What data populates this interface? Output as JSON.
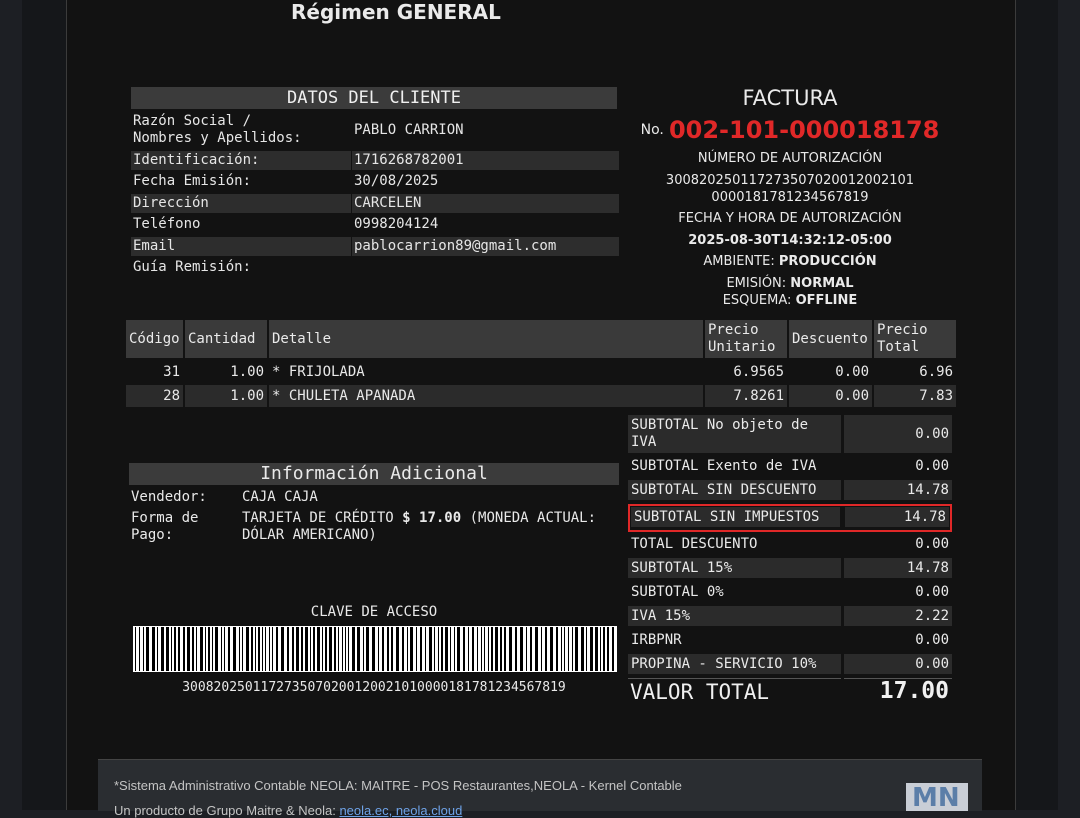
{
  "header": {
    "regimen": "Régimen GENERAL"
  },
  "cliente": {
    "title": "DATOS DEL CLIENTE",
    "rows": [
      {
        "label": "Razón Social /\nNombres y Apellidos:",
        "value": "PABLO CARRION"
      },
      {
        "label": "Identificación:",
        "value": "1716268782001"
      },
      {
        "label": "Fecha Emisión:",
        "value": "30/08/2025"
      },
      {
        "label": "Dirección",
        "value": "CARCELEN"
      },
      {
        "label": "Teléfono",
        "value": "0998204124"
      },
      {
        "label": "Email",
        "value": "pablocarrion89@gmail.com"
      },
      {
        "label": "Guía Remisión:",
        "value": ""
      }
    ]
  },
  "factura": {
    "title": "FACTURA",
    "no_label": "No.",
    "number": "002-101-000018178",
    "auth_title": "NÚMERO DE AUTORIZACIÓN",
    "auth_line1": "300820250117273507020012002101",
    "auth_line2": "0000181781234567819",
    "fecha_title": "FECHA Y HORA DE AUTORIZACIÓN",
    "fecha_value": "2025-08-30T14:32:12-05:00",
    "ambiente_label": "AMBIENTE:",
    "ambiente_value": "PRODUCCIÓN",
    "emision_label": "EMISIÓN:",
    "emision_value": "NORMAL",
    "esquema_label": "ESQUEMA:",
    "esquema_value": "OFFLINE"
  },
  "items": {
    "headers": {
      "codigo": "Código",
      "cantidad": "Cantidad",
      "detalle": "Detalle",
      "precio_unitario": "Precio\nUnitario",
      "descuento": "Descuento",
      "precio_total": "Precio\nTotal"
    },
    "rows": [
      {
        "codigo": "31",
        "cantidad": "1.00",
        "detalle": "* FRIJOLADA",
        "precio_unitario": "6.9565",
        "descuento": "0.00",
        "precio_total": "6.96"
      },
      {
        "codigo": "28",
        "cantidad": "1.00",
        "detalle": "* CHULETA APANADA",
        "precio_unitario": "7.8261",
        "descuento": "0.00",
        "precio_total": "7.83"
      }
    ]
  },
  "totales": [
    {
      "label": "SUBTOTAL No objeto de\nIVA",
      "value": "0.00"
    },
    {
      "label": "SUBTOTAL Exento de IVA",
      "value": "0.00"
    },
    {
      "label": "SUBTOTAL SIN DESCUENTO",
      "value": "14.78"
    },
    {
      "label": "SUBTOTAL SIN IMPUESTOS",
      "value": "14.78"
    },
    {
      "label": "TOTAL DESCUENTO",
      "value": "0.00"
    },
    {
      "label": "SUBTOTAL 15%",
      "value": "14.78"
    },
    {
      "label": "SUBTOTAL 0%",
      "value": "0.00"
    },
    {
      "label": "IVA 15%",
      "value": "2.22"
    },
    {
      "label": "IRBPNR",
      "value": "0.00"
    },
    {
      "label": "PROPINA - SERVICIO 10%",
      "value": "0.00"
    }
  ],
  "valor_total": {
    "label": "VALOR TOTAL",
    "value": "17.00"
  },
  "info_adicional": {
    "title": "Información Adicional",
    "vendedor_label": "Vendedor:",
    "vendedor_value": "CAJA CAJA",
    "pago_label": "Forma de\nPago:",
    "pago_prefix": "TARJETA DE CRÉDITO ",
    "pago_amount": "$ 17.00",
    "pago_suffix": " (MONEDA ACTUAL:\nDÓLAR AMERICANO)"
  },
  "clave": {
    "title": "CLAVE DE ACCESO",
    "value": "3008202501172735070200120021010000181781234567819"
  },
  "footer": {
    "line1": "*Sistema Administrativo Contable NEOLA: MAITRE - POS Restaurantes,NEOLA - Kernel Contable",
    "line2_prefix": "Un producto de Grupo Maitre & Neola: ",
    "line2_link": "neola.ec, neola.cloud",
    "logo_text": "MN"
  },
  "colors": {
    "accent_red": "#e02828",
    "link_blue": "#6fa3e8"
  }
}
